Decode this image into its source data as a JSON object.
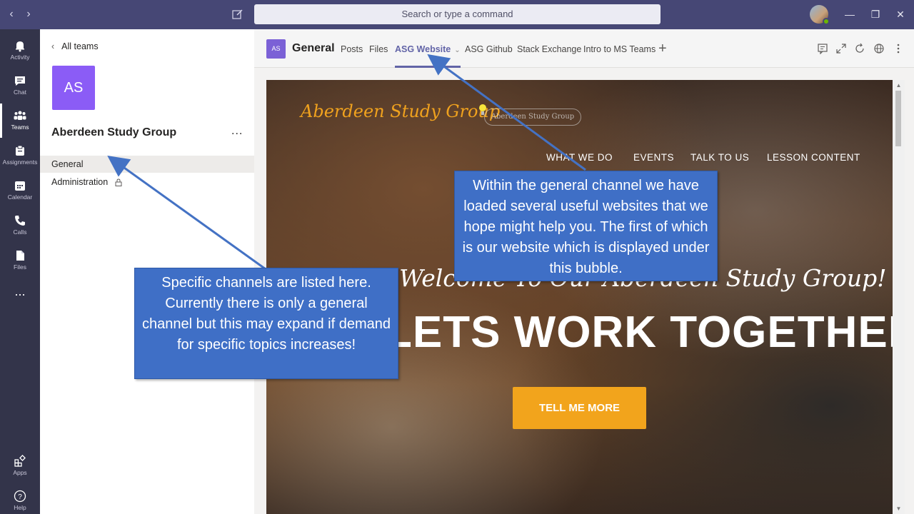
{
  "search": {
    "placeholder": "Search or type a command"
  },
  "rail": {
    "items": [
      {
        "label": "Activity",
        "icon": "bell-icon"
      },
      {
        "label": "Chat",
        "icon": "chat-icon"
      },
      {
        "label": "Teams",
        "icon": "teams-icon",
        "active": true
      },
      {
        "label": "Assignments",
        "icon": "assignments-icon"
      },
      {
        "label": "Calendar",
        "icon": "calendar-icon"
      },
      {
        "label": "Calls",
        "icon": "phone-icon"
      },
      {
        "label": "Files",
        "icon": "files-icon"
      }
    ],
    "more": "...",
    "apps_label": "Apps",
    "help_label": "Help"
  },
  "pane": {
    "back_label": "All teams",
    "team_initials": "AS",
    "team_name": "Aberdeen Study Group",
    "more": "...",
    "channels": [
      {
        "name": "General",
        "selected": true
      },
      {
        "name": "Administration",
        "locked": true
      }
    ]
  },
  "channel": {
    "initials": "AS",
    "name": "General",
    "tabs": [
      "Posts",
      "Files",
      "ASG Website",
      "ASG Github",
      "Stack Exchange",
      "Intro to MS Teams"
    ],
    "active_tab": "ASG Website",
    "accent_color": "#6264a7"
  },
  "website": {
    "logo_text": "Aberdeen Study Group",
    "logo_sketch": "Aberdeen Study Group",
    "nav": [
      "WHAT WE DO",
      "EVENTS",
      "TALK TO US",
      "LESSON CONTENT"
    ],
    "welcome": "Welcome To Our Aberdeen Study Group!",
    "hero": "LETS WORK TOGETHER",
    "cta": "TELL ME MORE",
    "accent_color": "#f2a41c"
  },
  "callouts": {
    "left": "Specific channels are listed here. Currently there is only a general channel but this may expand if demand for specific topics increases!",
    "right": "Within the general channel we have loaded several useful websites that we hope might help you. The first of which is our website which is displayed under this bubble."
  }
}
